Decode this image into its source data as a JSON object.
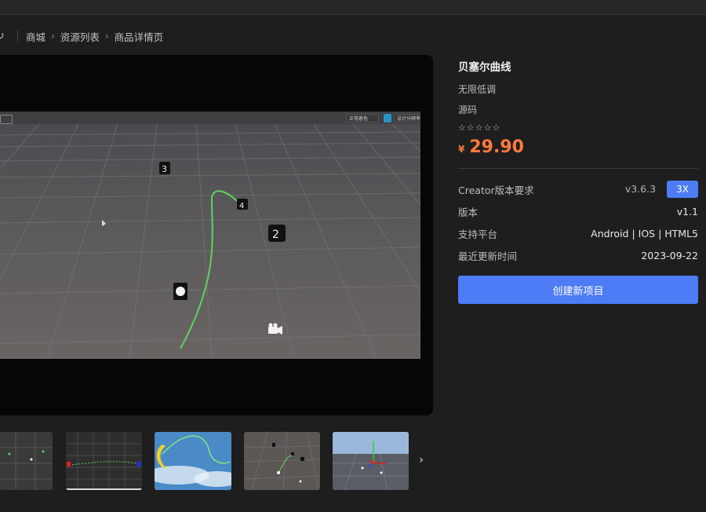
{
  "breadcrumb": {
    "items": [
      "商城",
      "资源列表",
      "商品详情页"
    ]
  },
  "scene_toolbar": {
    "dropdown_label": "正常着色",
    "design_label": "设计分辨率"
  },
  "product": {
    "title": "贝塞尔曲线",
    "tag_line": "无限低调",
    "category": "源码",
    "rating": "☆☆☆☆☆",
    "currency": "¥",
    "price": "29.90"
  },
  "specs": {
    "creator_label": "Creator版本要求",
    "creator_value": "v3.6.3",
    "creator_badge": "3X",
    "version_label": "版本",
    "version_value": "v1.1",
    "platform_label": "支持平台",
    "platform_value": "Android | IOS | HTML5",
    "updated_label": "最近更新时间",
    "updated_value": "2023-09-22"
  },
  "actions": {
    "create_label": "创建新项目"
  },
  "icons": {
    "refresh": "refresh-icon",
    "chevron": "chevron-right-icon",
    "next": "chevron-right-icon",
    "camera": "camera-icon"
  },
  "colors": {
    "accent": "#4d7cf6",
    "price": "#ff7a3d",
    "curve": "#5fd35f"
  }
}
